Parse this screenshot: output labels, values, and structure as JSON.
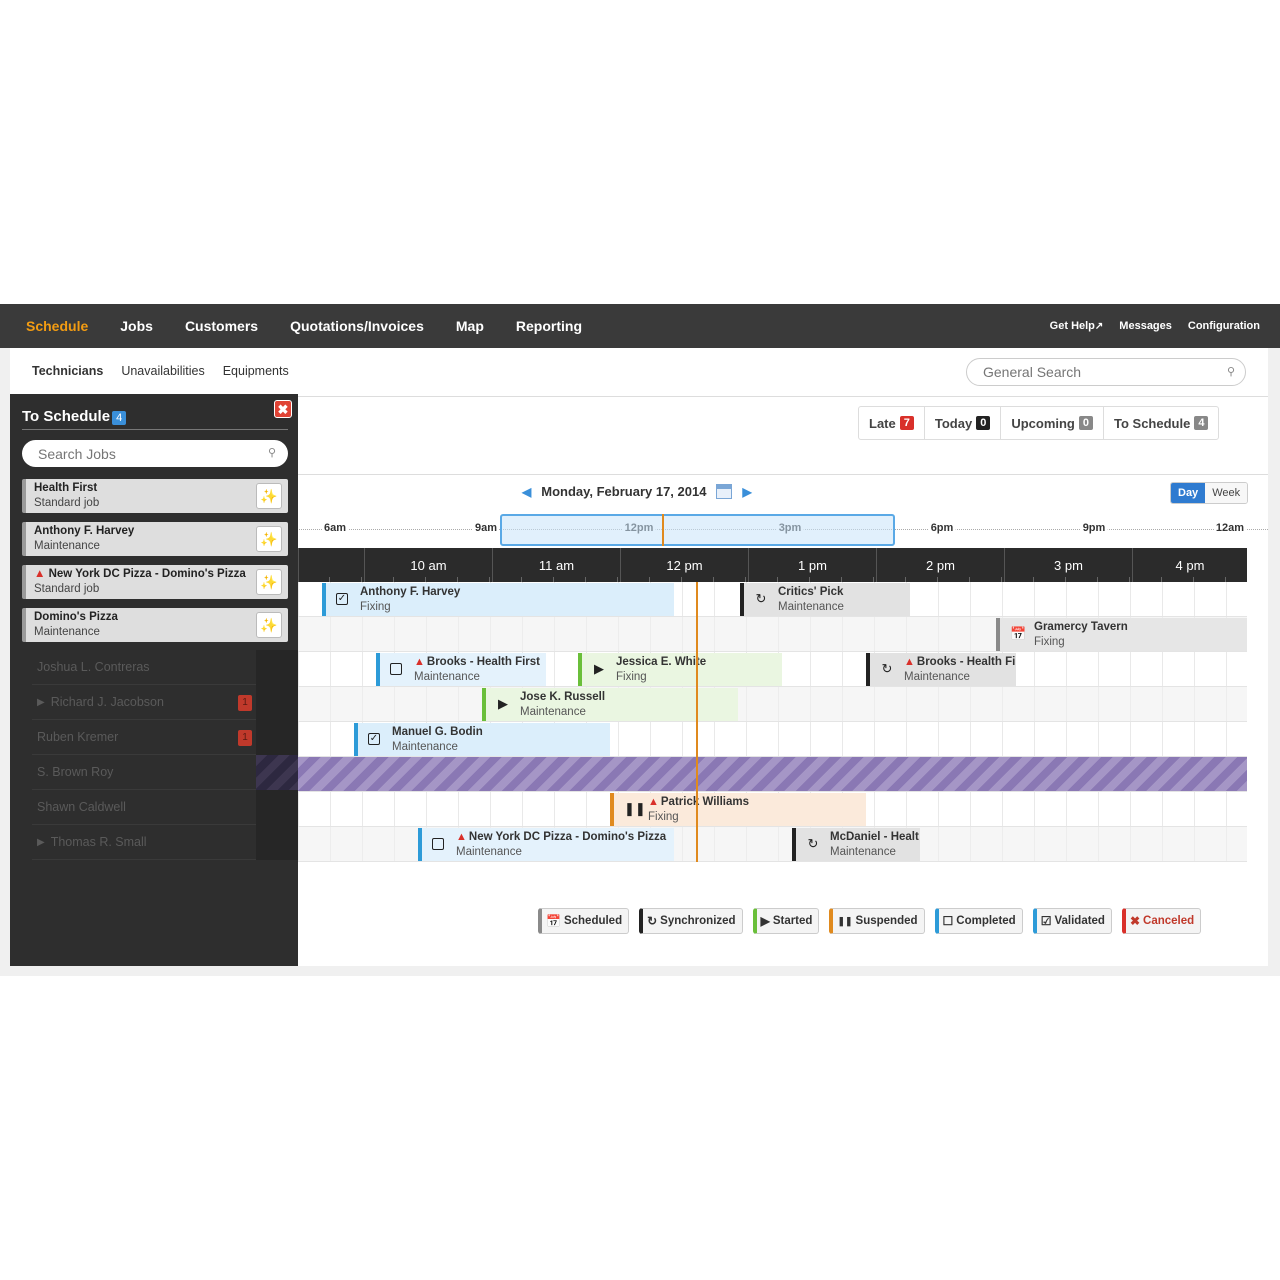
{
  "nav": {
    "items": [
      "Schedule",
      "Jobs",
      "Customers",
      "Quotations/Invoices",
      "Map",
      "Reporting"
    ],
    "active": "Schedule",
    "right": [
      "Get Help",
      "Messages",
      "Configuration"
    ]
  },
  "subtabs": [
    "Technicians",
    "Unavailabilities",
    "Equipments"
  ],
  "search": {
    "placeholder": "General Search"
  },
  "counters": [
    {
      "label": "Late",
      "count": "7",
      "color": "#d9302a"
    },
    {
      "label": "Today",
      "count": "0",
      "color": "#222222"
    },
    {
      "label": "Upcoming",
      "count": "0",
      "color": "#888888"
    },
    {
      "label": "To Schedule",
      "count": "4",
      "color": "#888888"
    }
  ],
  "date": {
    "label": "Monday, February 17, 2014"
  },
  "view": {
    "day": "Day",
    "week": "Week"
  },
  "overview": [
    "6am",
    "9am",
    "12pm",
    "3pm",
    "6pm",
    "9pm",
    "12am"
  ],
  "hours": [
    "10 am",
    "11 am",
    "12 pm",
    "1 pm",
    "2 pm",
    "3 pm",
    "4 pm"
  ],
  "sidebar": {
    "title": "To Schedule",
    "count": "4",
    "search_placeholder": "Search Jobs",
    "cards": [
      {
        "title": "Health First",
        "sub": "Standard job",
        "warn": false
      },
      {
        "title": "Anthony F. Harvey",
        "sub": "Maintenance",
        "warn": false
      },
      {
        "title": "New York DC Pizza - Domino's Pizza",
        "sub": "Standard job",
        "warn": true
      },
      {
        "title": "Domino's Pizza",
        "sub": "Maintenance",
        "warn": false
      }
    ]
  },
  "technicians": [
    {
      "name": "Joshua L. Contreras",
      "expand": false,
      "badge": ""
    },
    {
      "name": "Richard J. Jacobson",
      "expand": true,
      "badge": "1"
    },
    {
      "name": "Ruben Kremer",
      "expand": false,
      "badge": "1"
    },
    {
      "name": "S. Brown Roy",
      "expand": false,
      "badge": ""
    },
    {
      "name": "Shawn Caldwell",
      "expand": false,
      "badge": ""
    },
    {
      "name": "Thomas R. Small",
      "expand": true,
      "badge": ""
    }
  ],
  "jobs": [
    {
      "title": "Anthony F. Harvey",
      "sub": "Fixing",
      "status": "validated",
      "warn": false
    },
    {
      "title": "Critics' Pick",
      "sub": "Maintenance",
      "status": "sync",
      "warn": false
    },
    {
      "title": "Gramercy Tavern",
      "sub": "Fixing",
      "status": "scheduled",
      "warn": false
    },
    {
      "title": "Brooks - Health First",
      "sub": "Maintenance",
      "status": "completed",
      "warn": true
    },
    {
      "title": "Jessica E. White",
      "sub": "Fixing",
      "status": "started",
      "warn": false
    },
    {
      "title": "Brooks - Health Fi",
      "sub": "Maintenance",
      "status": "sync",
      "warn": true
    },
    {
      "title": "Jose K. Russell",
      "sub": "Maintenance",
      "status": "started",
      "warn": false
    },
    {
      "title": "Manuel G. Bodin",
      "sub": "Maintenance",
      "status": "validated",
      "warn": false
    },
    {
      "title": "Patrick Williams",
      "sub": "Fixing",
      "status": "suspended",
      "warn": true
    },
    {
      "title": "New York DC Pizza - Domino's Pizza",
      "sub": "Maintenance",
      "status": "completed",
      "warn": true
    },
    {
      "title": "McDaniel - Healt",
      "sub": "Maintenance",
      "status": "sync",
      "warn": false
    }
  ],
  "legend": [
    {
      "label": "Scheduled",
      "color": "#8a8a8a"
    },
    {
      "label": "Synchronized",
      "color": "#222222"
    },
    {
      "label": "Started",
      "color": "#6abf3a"
    },
    {
      "label": "Suspended",
      "color": "#e08a1e"
    },
    {
      "label": "Completed",
      "color": "#2d9bd8"
    },
    {
      "label": "Validated",
      "color": "#2d9bd8"
    },
    {
      "label": "Canceled",
      "color": "#d9302a"
    }
  ]
}
